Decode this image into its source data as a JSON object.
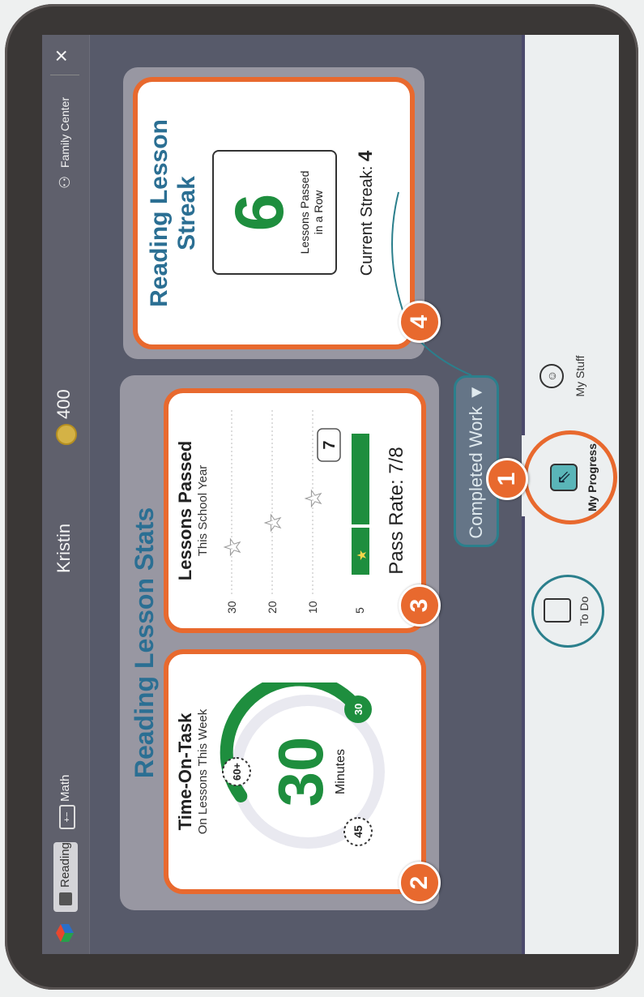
{
  "topbar": {
    "reading_tab": "Reading",
    "math_tab": "Math",
    "student_name": "Kristin",
    "coins": "400",
    "family_center": "Family Center",
    "close": "×"
  },
  "section_title": "Reading Lesson Stats",
  "time_card": {
    "title": "Time-On-Task",
    "subtitle": "On Lessons This Week",
    "value": "30",
    "unit": "Minutes",
    "markers": [
      "45",
      "60+",
      "30"
    ],
    "progress_fraction": 0.62
  },
  "lessons_card": {
    "title": "Lessons Passed",
    "subtitle": "This School Year",
    "ticks": [
      "30",
      "20",
      "10",
      "5"
    ],
    "value_label": "7",
    "pass_rate": "Pass Rate: 7/8"
  },
  "streak_card": {
    "title_line1": "Reading Lesson",
    "title_line2": "Streak",
    "value": "6",
    "label_line1": "Lessons Passed",
    "label_line2": "in a Row",
    "current_prefix": "Current Streak: ",
    "current_value": "4"
  },
  "completed_work": "Completed Work ▼",
  "bottom_nav": {
    "todo": "To Do",
    "my_progress": "My Progress",
    "my_stuff": "My Stuff"
  },
  "callouts": [
    "1",
    "2",
    "3",
    "4"
  ],
  "colors": {
    "accent": "#e8692e",
    "green": "#1e8e3e",
    "teal": "#2b7f8c",
    "screen_bg": "#575a6a"
  }
}
